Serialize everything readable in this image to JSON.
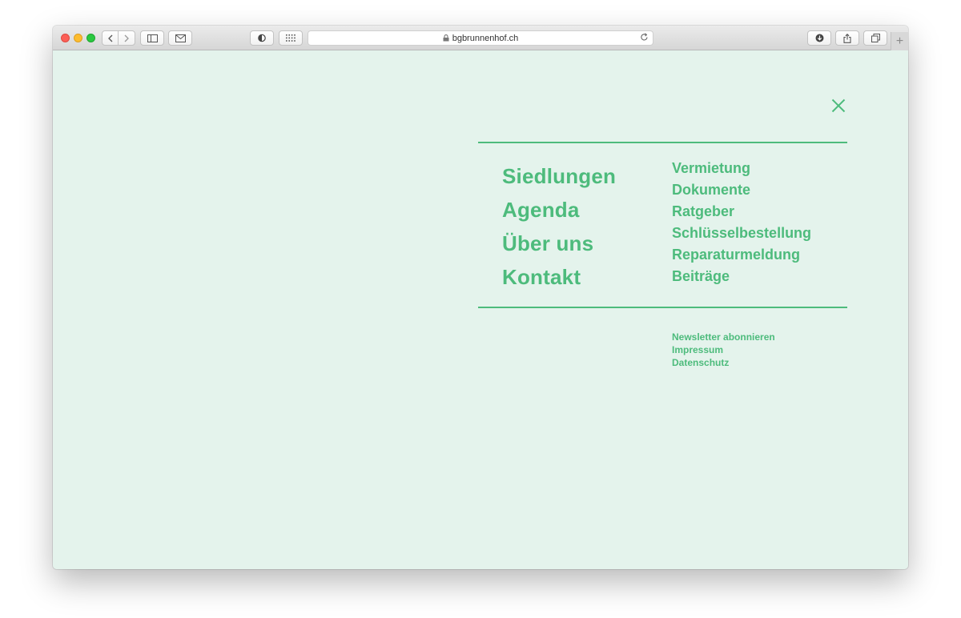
{
  "browser": {
    "url": "bgbrunnenhof.ch",
    "icons": {
      "back": "chevron-left-icon",
      "forward": "chevron-right-icon",
      "sidebar": "sidebar-icon",
      "mail": "mail-icon",
      "shield": "shield-icon",
      "grid": "grid-icon",
      "lock": "lock-icon",
      "reload": "reload-icon",
      "download": "download-icon",
      "share": "share-icon",
      "tabs": "tabs-icon",
      "new_tab": "plus-icon"
    },
    "new_tab_label": "+"
  },
  "menu": {
    "close_icon": "close-icon",
    "main_items": [
      "Siedlungen",
      "Agenda",
      "Über uns",
      "Kontakt"
    ],
    "sub_items": [
      "Vermietung",
      "Dokumente",
      "Ratgeber",
      "Schlüsselbestellung",
      "Reparaturmeldung",
      "Beiträge"
    ],
    "footer_links": [
      "Newsletter abonnieren",
      "Impressum",
      "Datenschutz"
    ]
  },
  "colors": {
    "accent": "#4dbb7c",
    "background": "#e4f3ec"
  }
}
